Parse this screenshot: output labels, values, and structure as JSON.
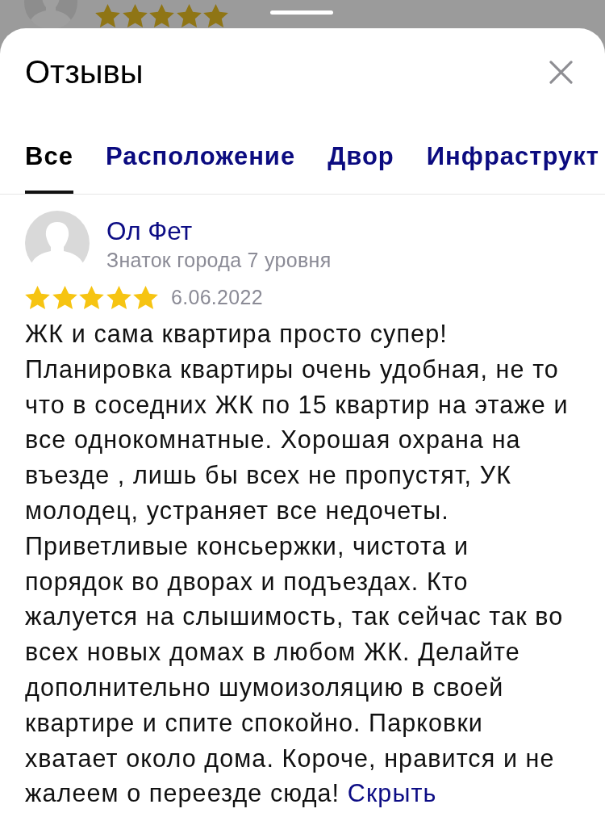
{
  "background_review": {
    "stars": 5
  },
  "sheet": {
    "title": "Отзывы"
  },
  "tabs": [
    {
      "label": "Все",
      "selected": true
    },
    {
      "label": "Расположение",
      "selected": false
    },
    {
      "label": "Двор",
      "selected": false
    },
    {
      "label": "Инфраструкт",
      "selected": false
    }
  ],
  "reviews": [
    {
      "author": "Ол Фет",
      "badge": "Знаток города 7 уровня",
      "stars": 5,
      "date": "6.06.2022",
      "text": "ЖК и сама квартира просто супер! Планировка квартиры очень удобная, не то что в соседних ЖК по 15 квартир на этаже и все однокомнатные. Хорошая охрана на въезде , лишь бы всех не пропустят, УК молодец, устраняет все недочеты. Приветливые консьержки, чистота и порядок во дворах и подъездах. Кто жалуется на слышимость, так сейчас так во всех новых домах в любом ЖК. Делайте дополнительно шумоизоляцию в своей квартире и спите спокойно. Парковки хватает около дома. Короче, нравится и не жалеем о переезде сюда!",
      "toggle": "Скрыть"
    }
  ]
}
